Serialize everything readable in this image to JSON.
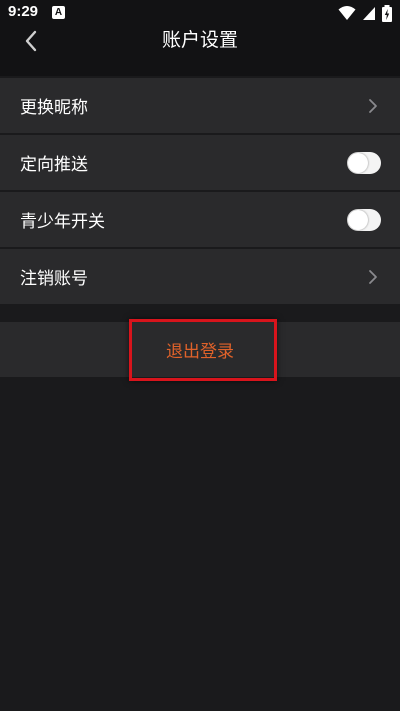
{
  "status_bar": {
    "time": "9:29",
    "notification_icon_letter": "A",
    "icons": [
      "wifi-icon",
      "signal-icon",
      "battery-charging-icon"
    ]
  },
  "header": {
    "title": "账户设置",
    "back_icon": "chevron-left-icon"
  },
  "settings": {
    "items": [
      {
        "label": "更换昵称",
        "control": "chevron-right-icon"
      },
      {
        "label": "定向推送",
        "control": "toggle",
        "enabled": false
      },
      {
        "label": "青少年开关",
        "control": "toggle",
        "enabled": false
      },
      {
        "label": "注销账号",
        "control": "chevron-right-icon"
      }
    ]
  },
  "logout": {
    "label": "退出登录"
  },
  "colors": {
    "background": "#1a1a1c",
    "row_background": "#2a2a2c",
    "logout_text": "#e0622a",
    "highlight_border": "#d8141c"
  }
}
